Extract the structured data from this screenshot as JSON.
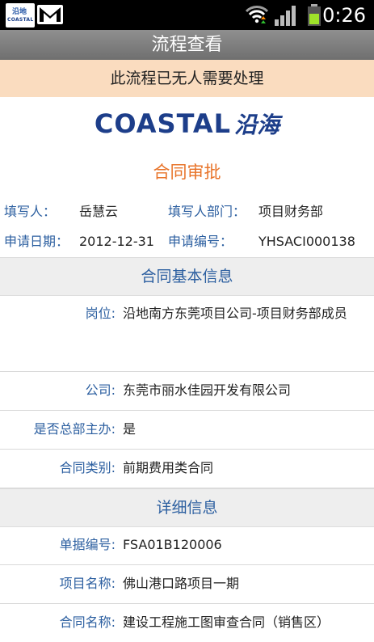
{
  "statusbar": {
    "time": "0:26",
    "app_icon_mark": "沿地",
    "app_icon_word": "COASTAL"
  },
  "header": {
    "title": "流程查看",
    "notice": "此流程已无人需要处理"
  },
  "logo": {
    "word": "COASTAL",
    "cn": "沿海"
  },
  "document": {
    "title": "合同审批"
  },
  "meta": {
    "writer_label": "填写人：",
    "writer_value": "岳慧云",
    "dept_label": "填写人部门：",
    "dept_value": "项目财务部",
    "date_label": "申请日期：",
    "date_value": "2012-12-31",
    "no_label": "申请编号：",
    "no_value": "YHSACI000138"
  },
  "basic_info": {
    "title": "合同基本信息",
    "rows": [
      {
        "label": "岗位:",
        "value": "沿地南方东莞项目公司-项目财务部成员"
      },
      {
        "label": "公司:",
        "value": "东莞市丽水佳园开发有限公司"
      },
      {
        "label": "是否总部主办:",
        "value": "是"
      },
      {
        "label": "合同类别:",
        "value": "前期费用类合同"
      }
    ]
  },
  "detail_info": {
    "title": "详细信息",
    "rows": [
      {
        "label": "单据编号:",
        "value": "FSA01B120006"
      },
      {
        "label": "项目名称:",
        "value": "佛山港口路项目一期"
      },
      {
        "label": "合同名称:",
        "value": "建设工程施工图审查合同（销售区）"
      }
    ]
  },
  "colors": {
    "accent": "#e8742a",
    "label_blue": "#2c5fa0",
    "notice_bg": "#fadcbf",
    "brand": "#1d3e8a"
  }
}
